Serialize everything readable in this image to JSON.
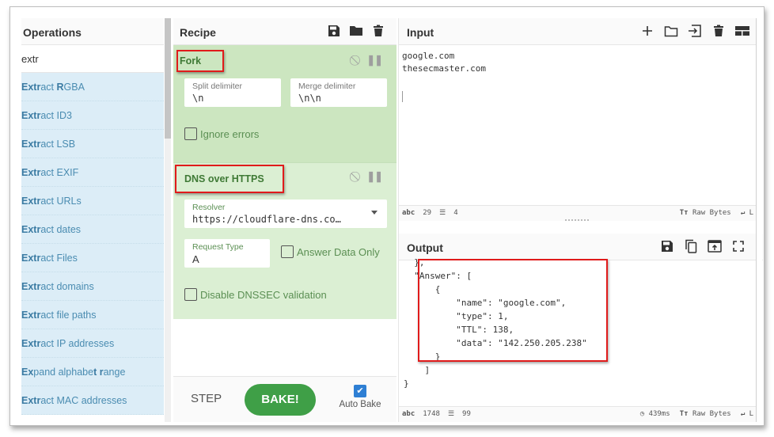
{
  "operations": {
    "title": "Operations",
    "search_value": "extr",
    "items": [
      {
        "parts": [
          {
            "t": "Ext",
            "b": true
          },
          {
            "t": "r",
            "b": true
          },
          {
            "t": "act ",
            "b": false
          },
          {
            "t": "R",
            "b": true
          },
          {
            "t": "GBA",
            "b": false
          }
        ],
        "label": "Extract RGBA"
      },
      {
        "parts": [
          {
            "t": "Extr",
            "b": true
          },
          {
            "t": "act ID3",
            "b": false
          }
        ],
        "label": "Extract ID3"
      },
      {
        "parts": [
          {
            "t": "Extr",
            "b": true
          },
          {
            "t": "act LSB",
            "b": false
          }
        ],
        "label": "Extract LSB"
      },
      {
        "parts": [
          {
            "t": "Extr",
            "b": true
          },
          {
            "t": "act EXIF",
            "b": false
          }
        ],
        "label": "Extract EXIF"
      },
      {
        "parts": [
          {
            "t": "Extr",
            "b": true
          },
          {
            "t": "act URLs",
            "b": false
          }
        ],
        "label": "Extract URLs"
      },
      {
        "parts": [
          {
            "t": "Extr",
            "b": true
          },
          {
            "t": "act dates",
            "b": false
          }
        ],
        "label": "Extract dates"
      },
      {
        "parts": [
          {
            "t": "Extr",
            "b": true
          },
          {
            "t": "act Files",
            "b": false
          }
        ],
        "label": "Extract Files"
      },
      {
        "parts": [
          {
            "t": "Extr",
            "b": true
          },
          {
            "t": "act domains",
            "b": false
          }
        ],
        "label": "Extract domains"
      },
      {
        "parts": [
          {
            "t": "Extr",
            "b": true
          },
          {
            "t": "act file paths",
            "b": false
          }
        ],
        "label": "Extract file paths"
      },
      {
        "parts": [
          {
            "t": "Extr",
            "b": true
          },
          {
            "t": "act IP addresses",
            "b": false
          }
        ],
        "label": "Extract IP addresses"
      },
      {
        "parts": [
          {
            "t": "Ex",
            "b": true
          },
          {
            "t": "pand alphabe",
            "b": false
          },
          {
            "t": "t",
            "b": true
          },
          {
            "t": " ",
            "b": false
          },
          {
            "t": "r",
            "b": true
          },
          {
            "t": "ange",
            "b": false
          }
        ],
        "label": "Expand alphabet range"
      },
      {
        "parts": [
          {
            "t": "Extr",
            "b": true
          },
          {
            "t": "act MAC addresses",
            "b": false
          }
        ],
        "label": "Extract MAC addresses"
      }
    ]
  },
  "recipe": {
    "title": "Recipe",
    "header_icons": [
      "save-icon",
      "folder-icon",
      "trash-icon"
    ],
    "fork": {
      "title": "Fork",
      "split_label": "Split delimiter",
      "split_value": "\\n",
      "merge_label": "Merge delimiter",
      "merge_value": "\\n\\n",
      "ignore_errors_label": "Ignore errors",
      "ignore_errors_checked": false
    },
    "doh": {
      "title": "DNS over HTTPS",
      "resolver_label": "Resolver",
      "resolver_value": "https://cloudflare-dns.co…",
      "request_type_label": "Request Type",
      "request_type_value": "A",
      "answer_only_label": "Answer Data Only",
      "answer_only_checked": false,
      "disable_dnssec_label": "Disable DNSSEC validation",
      "disable_dnssec_checked": false
    },
    "step_label": "STEP",
    "bake_label": "BAKE!",
    "auto_bake_label": "Auto Bake",
    "auto_bake_checked": true
  },
  "input": {
    "title": "Input",
    "header_icons": [
      "plus-icon",
      "folder-icon",
      "import-icon",
      "trash-icon",
      "layout-icon"
    ],
    "text": "google.com\nthesecmaster.com",
    "status": {
      "chars": "29",
      "lines": "4",
      "format": "Raw Bytes",
      "eol": "L"
    }
  },
  "output": {
    "title": "Output",
    "header_icons": [
      "save-icon",
      "copy-icon",
      "replace-input-icon",
      "maximize-icon"
    ],
    "text": "  },\n  \"Answer\": [\n      {\n          \"name\": \"google.com\",\n          \"type\": 1,\n          \"TTL\": 138,\n          \"data\": \"142.250.205.238\"\n      }\n    ]\n}\n\n{",
    "status": {
      "chars": "1748",
      "lines": "99",
      "time": "439ms",
      "format": "Raw Bytes",
      "eol": "L"
    }
  },
  "colors": {
    "accent_red": "#e01b1b",
    "op_card_active": "#cce6c0",
    "op_card_inactive": "#dbefd3",
    "bake_green": "#3f9f47",
    "ops_list_bg": "#dcedf7",
    "checkbox_blue": "#2e7fd4"
  }
}
